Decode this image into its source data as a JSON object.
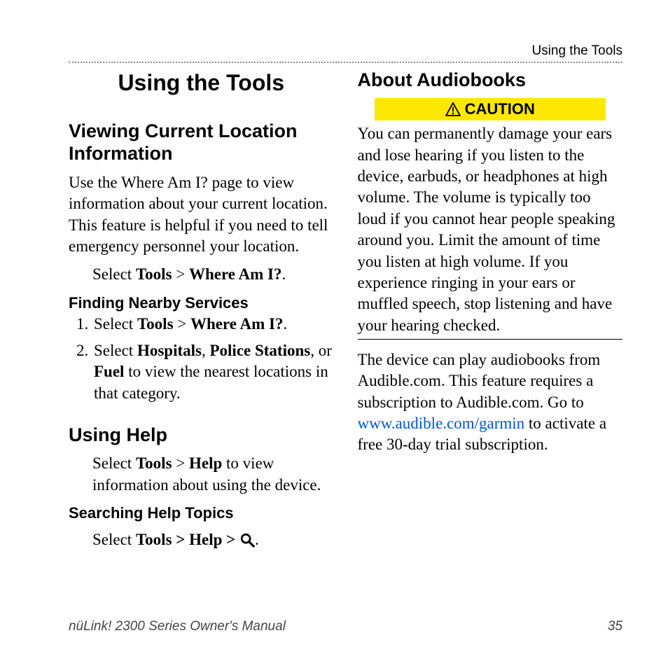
{
  "runningHead": "Using the Tools",
  "leftCol": {
    "h1": "Using the Tools",
    "sec1": {
      "heading": "Viewing Current Location Information",
      "para": "Use the Where Am I? page to view information about your current location. This feature is helpful if you need to tell emergency personnel your location.",
      "step_pre": "Select ",
      "step_tools": "Tools",
      "step_sep": " > ",
      "step_where": "Where Am I?",
      "step_post": "."
    },
    "sub1": {
      "heading": "Finding Nearby Services",
      "item1_pre": "Select ",
      "item1_tools": "Tools",
      "item1_sep": " > ",
      "item1_where": "Where Am I?",
      "item1_post": ".",
      "item2_pre": "Select ",
      "item2_b1": "Hospitals",
      "item2_mid1": ", ",
      "item2_b2": "Police Stations",
      "item2_mid2": ", or ",
      "item2_b3": "Fuel",
      "item2_post": " to view the nearest locations in that category."
    },
    "sec2": {
      "heading": "Using Help",
      "para_pre": "Select ",
      "para_tools": "Tools",
      "para_sep": " > ",
      "para_help": "Help",
      "para_post": " to view information about using the device."
    },
    "sub2": {
      "heading": "Searching Help Topics",
      "line_pre": "Select ",
      "line_b": "Tools > Help > ",
      "line_post": "."
    }
  },
  "rightCol": {
    "heading": "About Audiobooks",
    "cautionLabel": "CAUTION",
    "cautionText": "You can permanently damage your ears and lose hearing if you listen to the device, earbuds, or headphones at high volume. The volume is typically too loud if you cannot hear people speaking around you. Limit the amount of time you listen at high volume. If you experience ringing in your ears or muffled speech, stop listening and have your hearing checked.",
    "para2_pre": "The device can play audiobooks from Audible.com. This feature requires a subscription to Audible.com. Go to ",
    "para2_link": "www.audible.com/garmin",
    "para2_post": " to activate a free 30-day trial subscription."
  },
  "footer": {
    "left": "nüLink! 2300 Series Owner's Manual",
    "right": "35"
  }
}
